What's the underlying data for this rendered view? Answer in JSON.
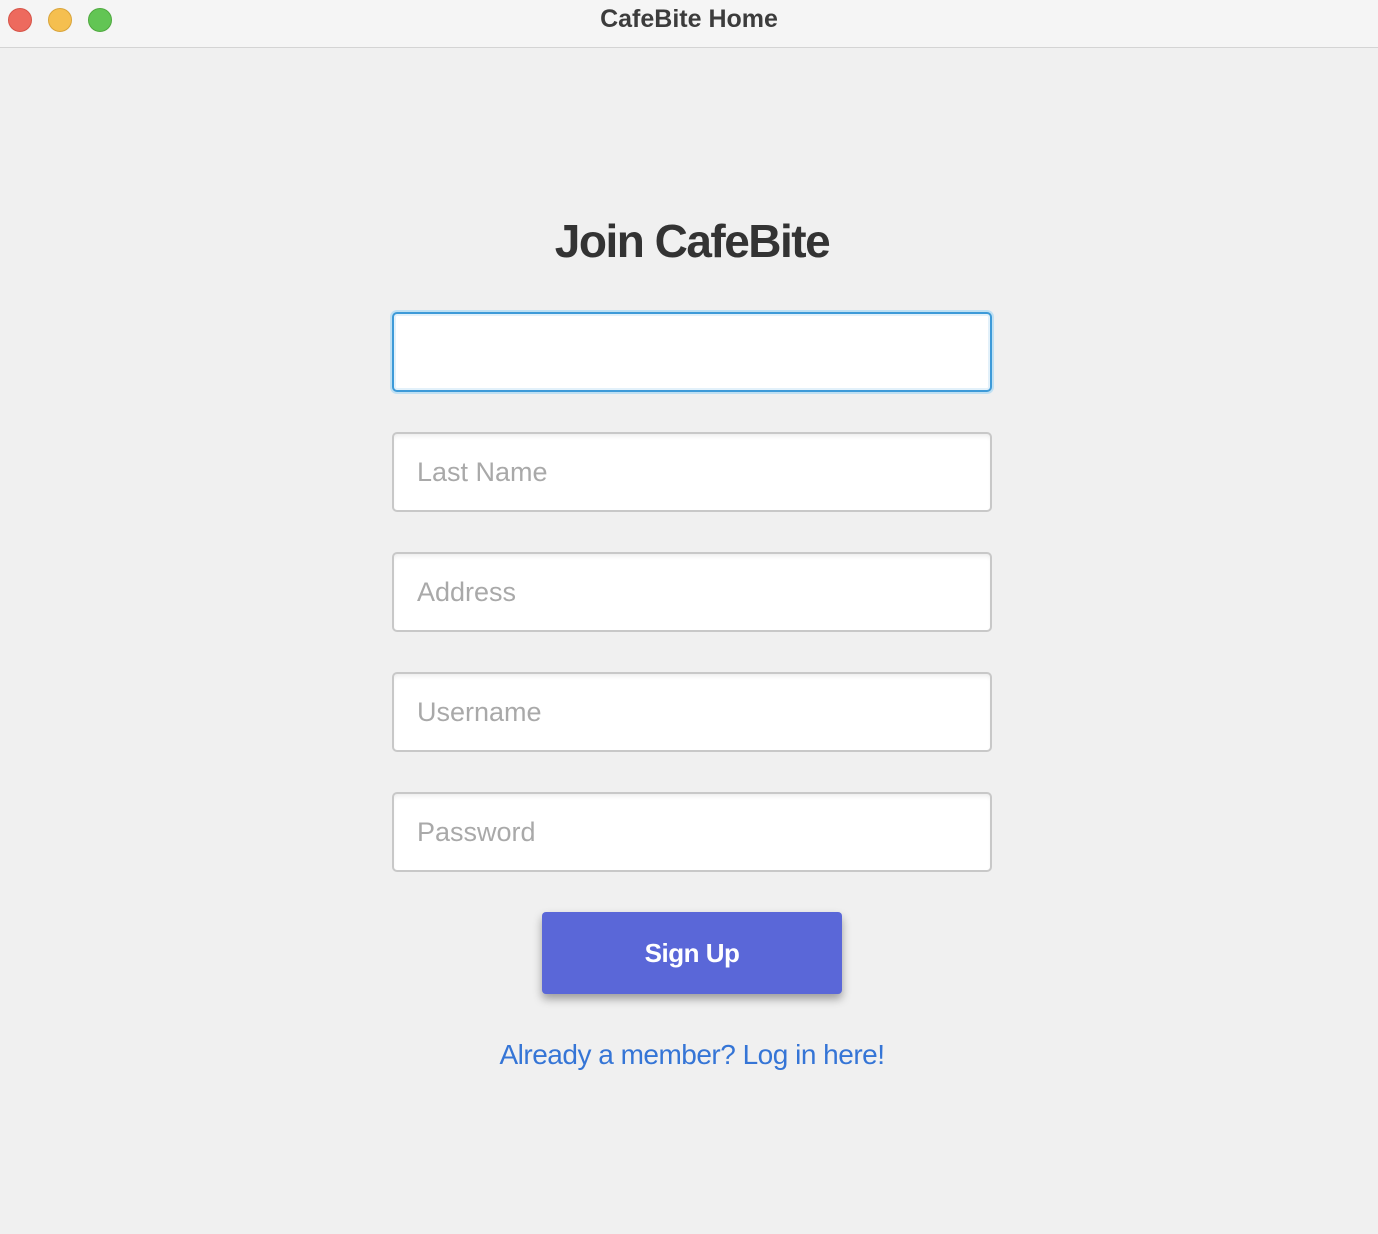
{
  "window": {
    "title": "CafeBite Home"
  },
  "form": {
    "heading": "Join CafeBite",
    "fields": [
      {
        "name": "first-name",
        "placeholder": "",
        "value": ""
      },
      {
        "name": "last-name",
        "placeholder": "Last Name",
        "value": ""
      },
      {
        "name": "address",
        "placeholder": "Address",
        "value": ""
      },
      {
        "name": "username",
        "placeholder": "Username",
        "value": ""
      },
      {
        "name": "password",
        "placeholder": "Password",
        "value": ""
      }
    ],
    "submit_label": "Sign Up",
    "login_link": "Already a member? Log in here!"
  },
  "colors": {
    "accent": "#5a67d8",
    "link": "#3575d6",
    "focus_ring": "#3d9ad8",
    "background": "#f0f0f0"
  }
}
